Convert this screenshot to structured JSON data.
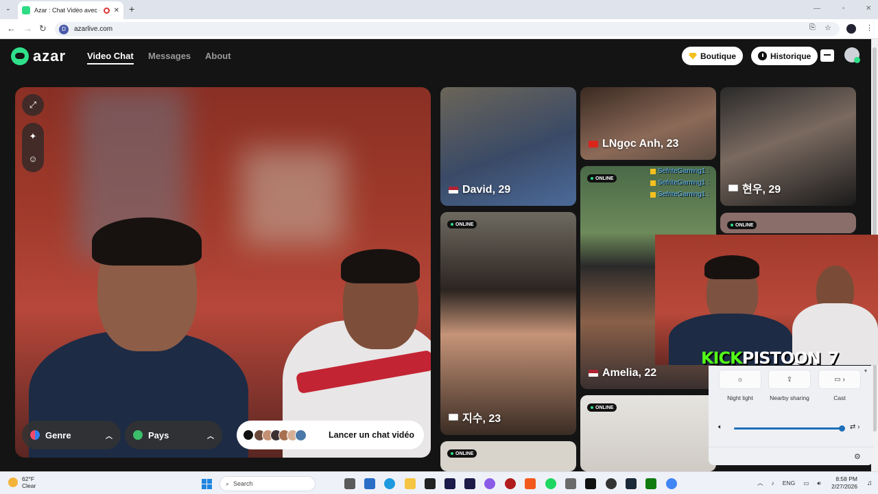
{
  "browser": {
    "tab_title": "Azar : Chat Vidéo avec de n",
    "tab_close": "✕",
    "new_tab": "+",
    "url": "azarlive.com"
  },
  "header": {
    "logo_text": "azar",
    "nav": [
      "Video Chat",
      "Messages",
      "About"
    ],
    "boutique": "Boutique",
    "historique": "Historique"
  },
  "controls": {
    "genre": "Genre",
    "pays": "Pays",
    "launch": "Lancer un chat vidéo"
  },
  "profiles": [
    {
      "name": "David, 29",
      "flag": "us",
      "online": false
    },
    {
      "name": "LNgọc Anh, 23",
      "flag": "vn",
      "online": false
    },
    {
      "name": "현우, 29",
      "flag": "kr",
      "online": false
    },
    {
      "name": "지수, 23",
      "flag": "kr",
      "online": true
    },
    {
      "name": "Amelia, 22",
      "flag": "us",
      "online": true
    }
  ],
  "online_label": "ONLINE",
  "stream": {
    "chat_lines": [
      "SefriteGaming1 :",
      "SefriteGaming1 :",
      "SefriteGaming1 :"
    ],
    "kick_word": "KICK",
    "channel": "PISTOON_7"
  },
  "quick_settings": {
    "tiles": [
      "Night light",
      "Nearby sharing",
      "Cast"
    ],
    "volume_percent": 100
  },
  "taskbar": {
    "temp": "62°F",
    "condition": "Clear",
    "search": "Search",
    "lang": "ENG",
    "time": "8:58 PM",
    "date": "2/27/2026"
  },
  "colors": {
    "accent": "#2fe08a",
    "kick": "#53fc18"
  }
}
